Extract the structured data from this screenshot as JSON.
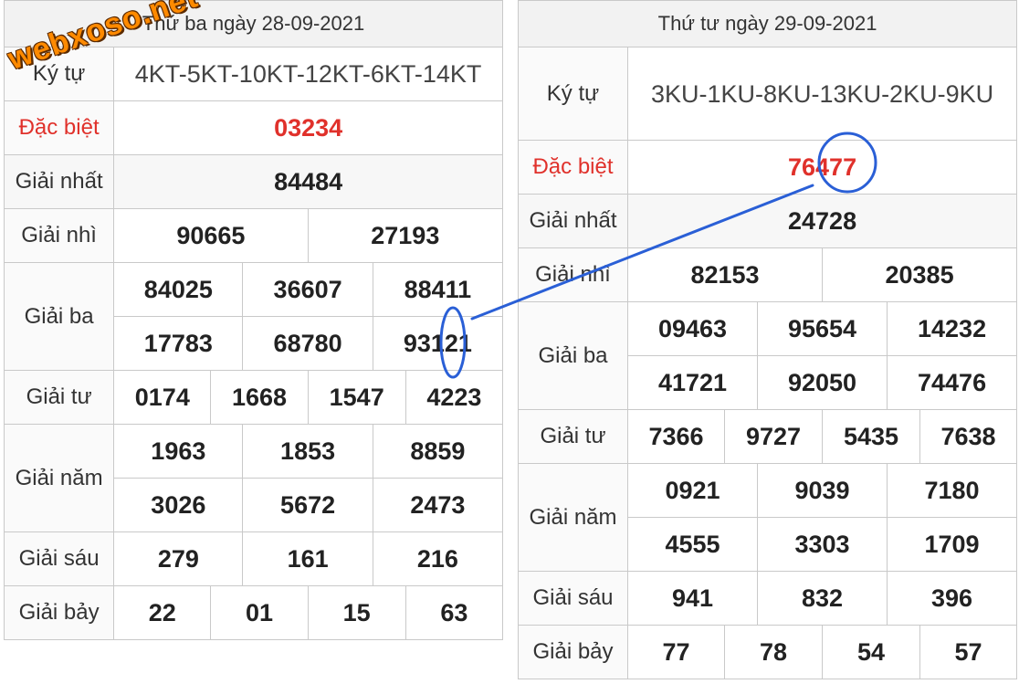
{
  "left": {
    "header": "Thứ ba ngày 28-09-2021",
    "labels": {
      "ky_tu": "Ký tự",
      "dac_biet": "Đặc biệt",
      "giai_nhat": "Giải nhất",
      "giai_nhi": "Giải nhì",
      "giai_ba": "Giải ba",
      "giai_tu": "Giải tư",
      "giai_nam": "Giải năm",
      "giai_sau": "Giải sáu",
      "giai_bay": "Giải bảy"
    },
    "ky_tu": "4KT-5KT-10KT-12KT-6KT-14KT",
    "dac_biet": "03234",
    "giai_nhat": "84484",
    "giai_nhi": [
      "90665",
      "27193"
    ],
    "giai_ba": [
      "84025",
      "36607",
      "88411",
      "17783",
      "68780",
      "93121"
    ],
    "giai_tu": [
      "0174",
      "1668",
      "1547",
      "4223"
    ],
    "giai_nam": [
      "1963",
      "1853",
      "8859",
      "3026",
      "5672",
      "2473"
    ],
    "giai_sau": [
      "279",
      "161",
      "216"
    ],
    "giai_bay": [
      "22",
      "01",
      "15",
      "63"
    ]
  },
  "right": {
    "header": "Thứ tư ngày 29-09-2021",
    "labels": {
      "ky_tu": "Ký tự",
      "dac_biet": "Đặc biệt",
      "giai_nhat": "Giải nhất",
      "giai_nhi": "Giải nhì",
      "giai_ba": "Giải ba",
      "giai_tu": "Giải tư",
      "giai_nam": "Giải năm",
      "giai_sau": "Giải sáu",
      "giai_bay": "Giải bảy"
    },
    "ky_tu": "3KU-1KU-8KU-13KU-2KU-9KU",
    "dac_biet": "76477",
    "giai_nhat": "24728",
    "giai_nhi": [
      "82153",
      "20385"
    ],
    "giai_ba": [
      "09463",
      "95654",
      "14232",
      "41721",
      "92050",
      "74476"
    ],
    "giai_tu": [
      "7366",
      "9727",
      "5435",
      "7638"
    ],
    "giai_nam": [
      "0921",
      "9039",
      "7180",
      "4555",
      "3303",
      "1709"
    ],
    "giai_sau": [
      "941",
      "832",
      "396"
    ],
    "giai_bay": [
      "77",
      "78",
      "54",
      "57"
    ]
  },
  "watermark": "webxoso.net",
  "colors": {
    "special_prize": "#e0312b",
    "annotation": "#2a5fd6",
    "watermark": "#ff8a00"
  }
}
